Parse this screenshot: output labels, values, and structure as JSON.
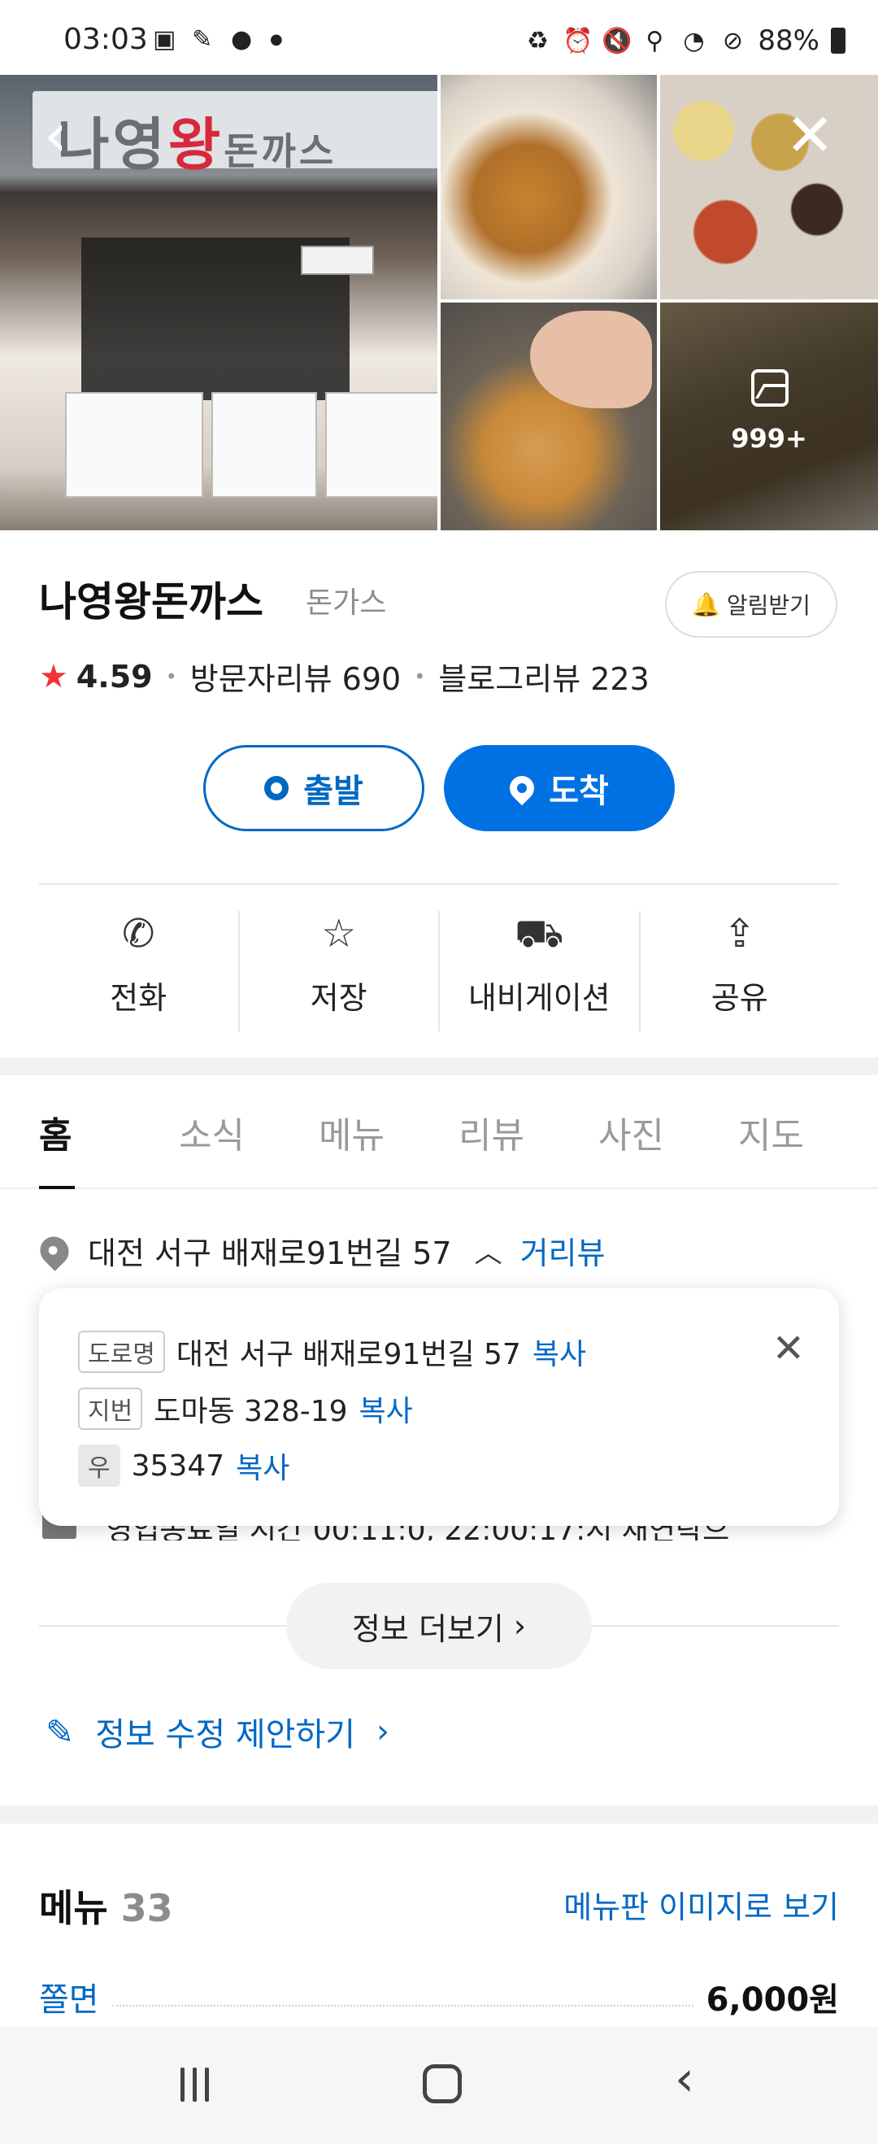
{
  "status_bar": {
    "time": "03:03",
    "battery": "88%"
  },
  "photos": {
    "more_count": "999+",
    "sign_parts": [
      "나영",
      "왕",
      "돈까스"
    ]
  },
  "place": {
    "name": "나영왕돈까스",
    "category": "돈가스",
    "alarm_label": "알림받기",
    "rating": "4.59",
    "visitor_reviews": "방문자리뷰 690",
    "blog_reviews": "블로그리뷰 223"
  },
  "route": {
    "depart_label": "출발",
    "arrive_label": "도착"
  },
  "actions": [
    {
      "label": "전화",
      "icon": "phone-icon"
    },
    {
      "label": "저장",
      "icon": "star-icon"
    },
    {
      "label": "내비게이션",
      "icon": "navigation-icon"
    },
    {
      "label": "공유",
      "icon": "share-icon"
    }
  ],
  "tabs": [
    "홈",
    "소식",
    "메뉴",
    "리뷰",
    "사진",
    "지도"
  ],
  "address": {
    "main": "대전 서구 배재로91번길 57",
    "street_view": "거리뷰",
    "road_tag": "도로명",
    "road": "대전 서구 배재로91번길 57",
    "lot_tag": "지번",
    "lot": "도마동 328-19",
    "zip_tag": "우",
    "zip": "35347",
    "copy": "복사",
    "hidden_line": "영업종료일 시간 00:11:0, 22:00:17:시 재연락으"
  },
  "more_info": "정보 더보기",
  "suggest_edit": "정보 수정 제안하기",
  "menu": {
    "title": "메뉴",
    "count": "33",
    "board_link": "메뉴판 이미지로 보기",
    "items": [
      {
        "name": "쫄면",
        "price": "6,000원"
      }
    ]
  },
  "colors": {
    "accent_blue": "#0071e3",
    "link_blue": "#0068c3",
    "star_red": "#f0343a"
  }
}
